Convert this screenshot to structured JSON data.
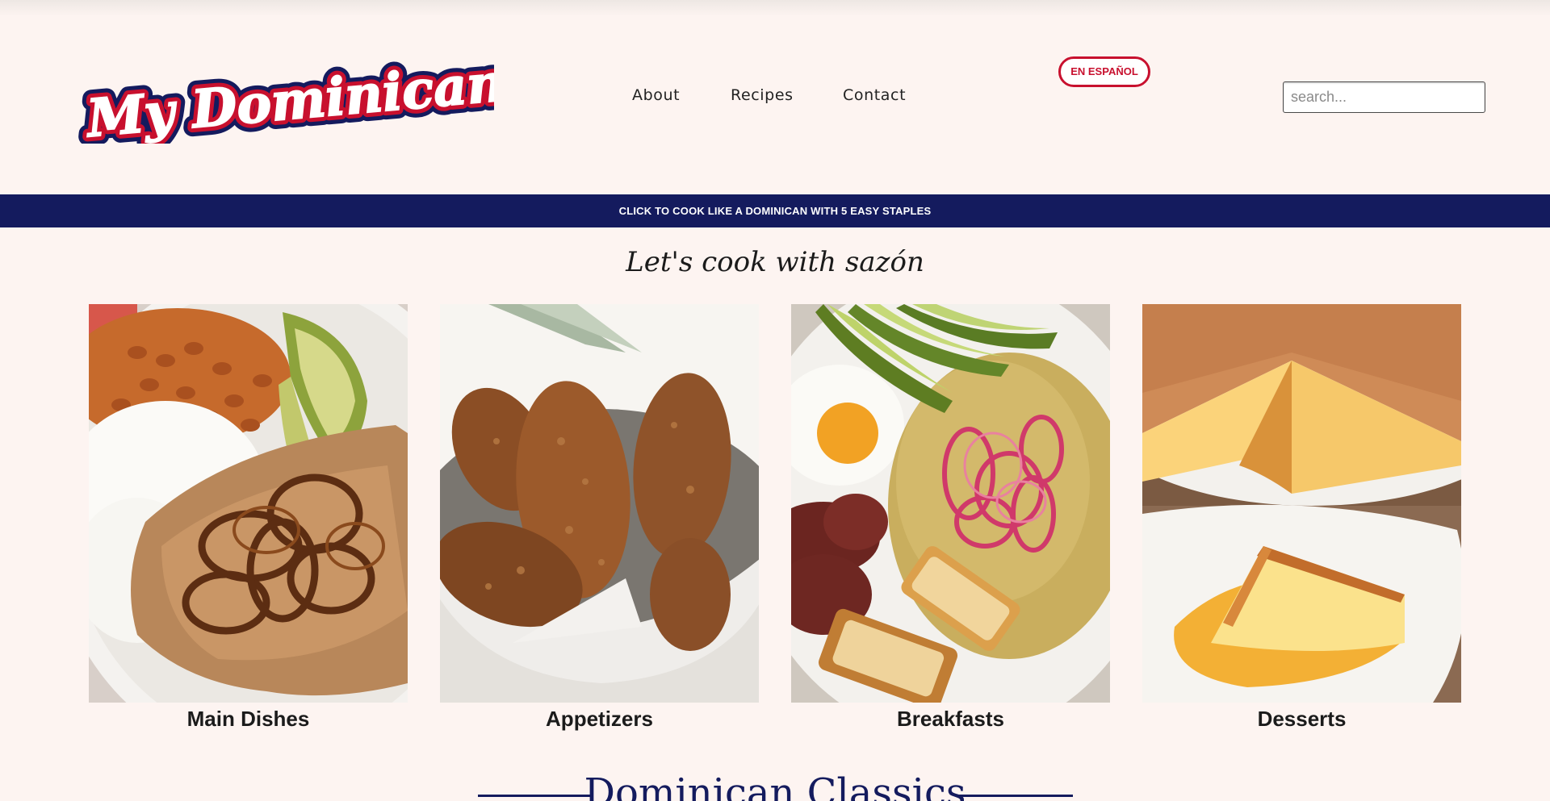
{
  "site": {
    "logo_text": "My Dominican Recipes"
  },
  "nav": {
    "items": [
      {
        "label": "About"
      },
      {
        "label": "Recipes"
      },
      {
        "label": "Contact"
      }
    ],
    "language_button": "EN ESPAÑOL",
    "search_placeholder": "search..."
  },
  "banner": {
    "text": "CLICK TO COOK LIKE A DOMINICAN WITH 5 EASY STAPLES"
  },
  "hero": {
    "tagline": "Let's cook with sazón"
  },
  "categories": [
    {
      "label": "Main Dishes"
    },
    {
      "label": "Appetizers"
    },
    {
      "label": "Breakfasts"
    },
    {
      "label": "Desserts"
    }
  ],
  "section": {
    "title": "Dominican Classics"
  },
  "colors": {
    "navy": "#141b5e",
    "red": "#c8102e",
    "background": "#fdf4f1"
  }
}
